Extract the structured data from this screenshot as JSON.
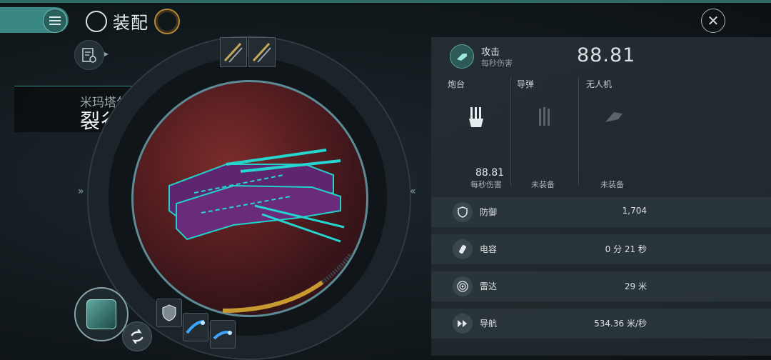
{
  "header": {
    "title": "装配",
    "menu_icon": "hamburger-icon",
    "close_icon": "close-icon"
  },
  "ship": {
    "faction": "米玛塔尔",
    "name": "裂谷级",
    "name_suffix": "»"
  },
  "chevrons": {
    "left": "»",
    "right": "«"
  },
  "panel": {
    "attack": {
      "label": "攻击",
      "sub": "每秒伤害",
      "value": "88.81"
    },
    "columns": [
      {
        "head": "炮台",
        "dps": "88.81",
        "dps_sub": "每秒伤害"
      },
      {
        "head": "导弹",
        "status": "未装备"
      },
      {
        "head": "无人机",
        "status": "未装备"
      }
    ],
    "stats": [
      {
        "name": "防御",
        "value": "1,704",
        "icon": "shield-icon"
      },
      {
        "name": "电容",
        "value": "0 分 21 秒",
        "icon": "capacitor-icon"
      },
      {
        "name": "雷达",
        "value": "29 米",
        "icon": "radar-icon"
      },
      {
        "name": "导航",
        "value": "534.36 米/秒",
        "icon": "navigation-icon"
      }
    ]
  },
  "colors": {
    "accent": "#3c8f89",
    "gold": "#c7992f",
    "planet": "#5a1f22",
    "ship_hull": "#6a2b7a",
    "ship_trim": "#25d6d0"
  },
  "capacitor_progress": 0.72
}
